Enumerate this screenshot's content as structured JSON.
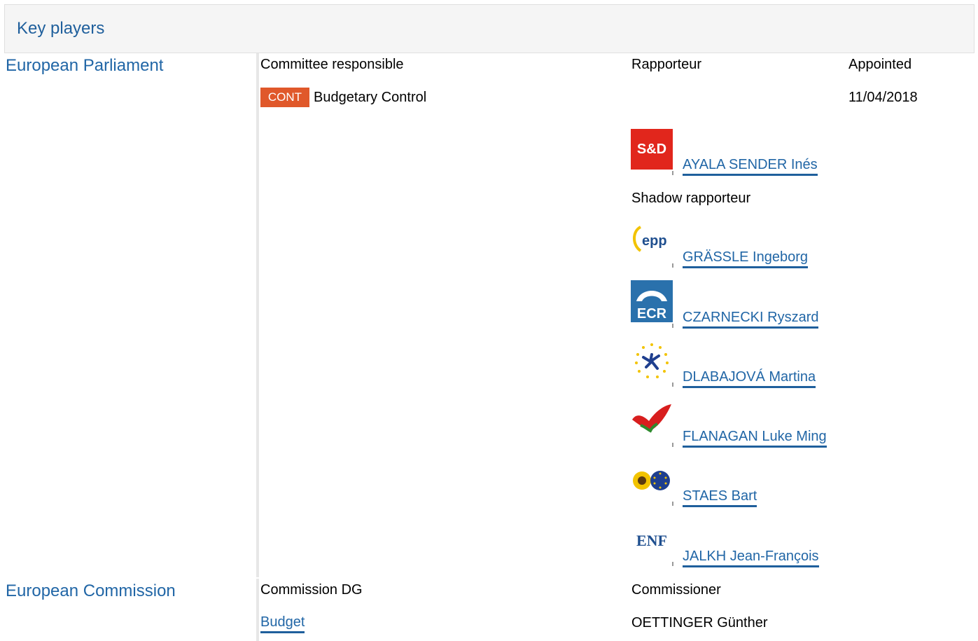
{
  "header": {
    "title": "Key players"
  },
  "parliament": {
    "label": "European Parliament",
    "committee_header": "Committee responsible",
    "rapporteur_header": "Rapporteur",
    "appointed_header": "Appointed",
    "committee": {
      "badge": "CONT",
      "name": "Budgetary Control",
      "appointed": "11/04/2018"
    },
    "rapporteur": {
      "group_logo": "S&D",
      "name": "AYALA SENDER Inés"
    },
    "shadow_header": "Shadow rapporteur",
    "shadows": [
      {
        "group_logo": "epp",
        "name": "GRÄSSLE Ingeborg"
      },
      {
        "group_logo": "ECR",
        "name": "CZARNECKI Ryszard"
      },
      {
        "group_logo": "alde-logo",
        "name": "DLABAJOVÁ Martina"
      },
      {
        "group_logo": "gue-logo",
        "name": "FLANAGAN Luke Ming"
      },
      {
        "group_logo": "greens-logo",
        "name": "STAES Bart"
      },
      {
        "group_logo": "ENF",
        "name": "JALKH Jean-François"
      }
    ]
  },
  "commission": {
    "label": "European Commission",
    "dg_header": "Commission DG",
    "commissioner_header": "Commissioner",
    "dg": "Budget",
    "commissioner": "OETTINGER Günther"
  },
  "colors": {
    "link": "#2166a6",
    "badge": "#e0582a",
    "header_bg": "#f5f5f5"
  }
}
